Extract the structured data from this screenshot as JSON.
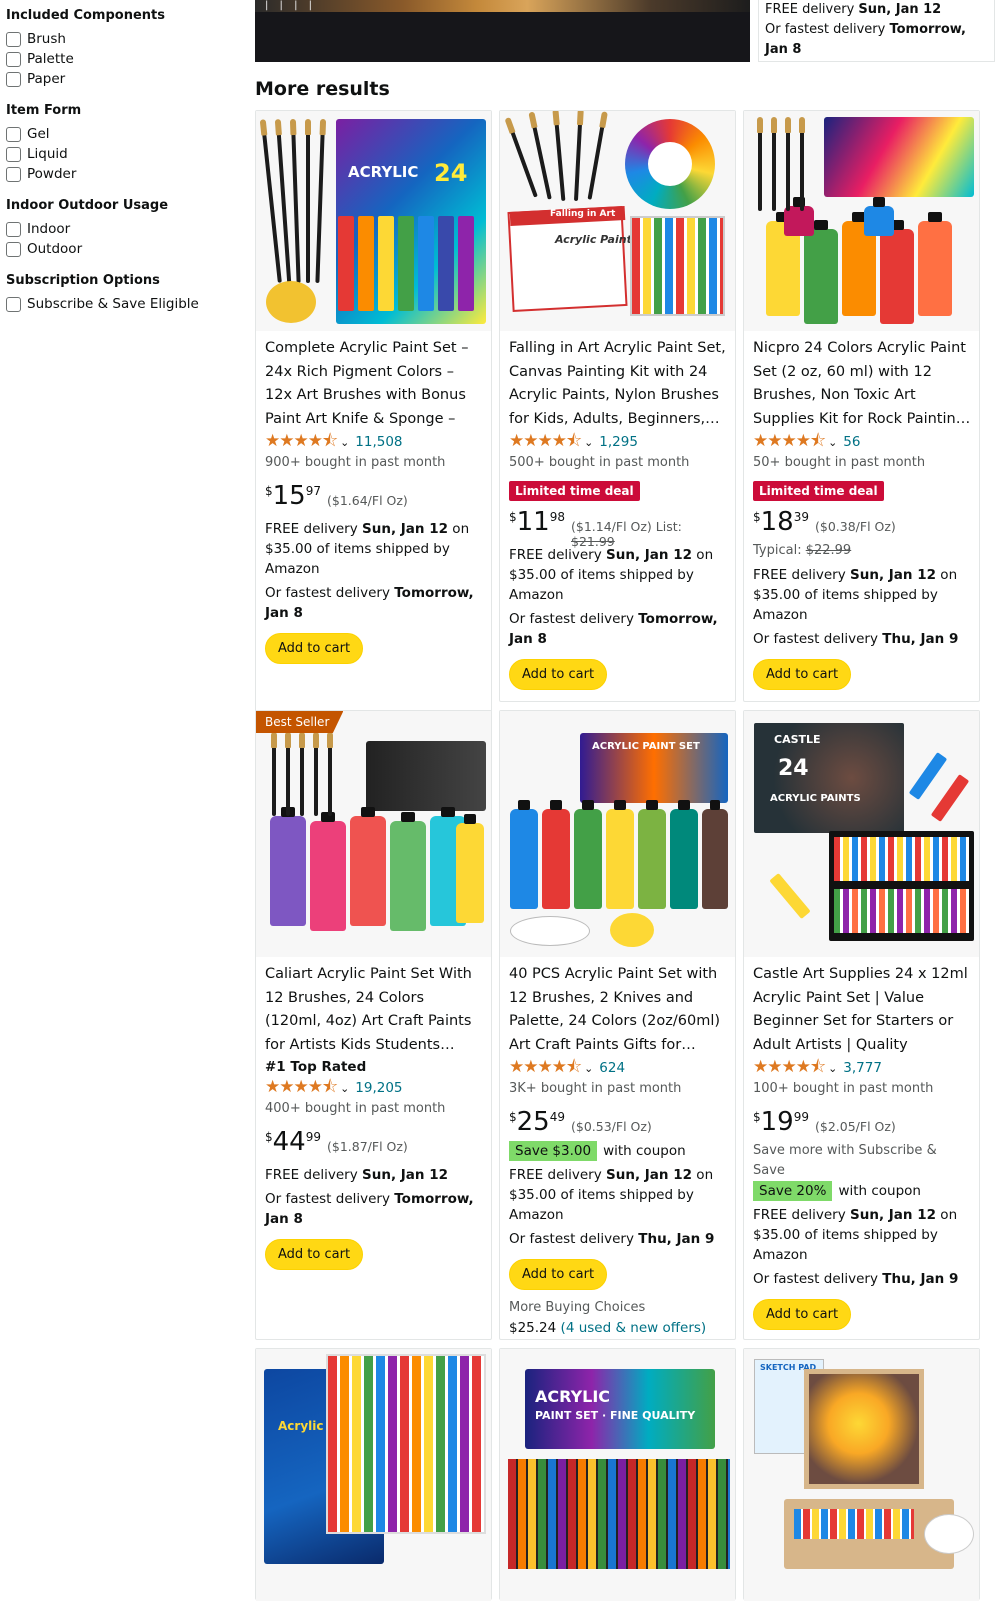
{
  "sidebar": {
    "groups": [
      {
        "heading": "Included Components",
        "options": [
          "Brush",
          "Palette",
          "Paper"
        ]
      },
      {
        "heading": "Item Form",
        "options": [
          "Gel",
          "Liquid",
          "Powder"
        ]
      },
      {
        "heading": "Indoor Outdoor Usage",
        "options": [
          "Indoor",
          "Outdoor"
        ]
      },
      {
        "heading": "Subscription Options",
        "options": [
          "Subscribe & Save Eligible"
        ]
      }
    ]
  },
  "top_strip": {
    "line1_prefix": "FREE delivery ",
    "line1_date": "Sun, Jan 12",
    "line2_prefix": "Or fastest delivery ",
    "line2_date": "Tomorrow, Jan 8"
  },
  "section_heading": "More results",
  "products": [
    {
      "title": "Complete Acrylic Paint Set – 24x Rich Pigment Colors – 12x Art Brushes with Bonus Paint Art Knife & Sponge – for…",
      "rating": "4.5",
      "rating_count": "11,508",
      "bought": "900+ bought in past month",
      "price_whole": "15",
      "price_frac": "97",
      "unit_price": "($1.64/Fl Oz)",
      "delivery_prefix": "FREE delivery ",
      "delivery_date": "Sun, Jan 12",
      "delivery_suffix": " on $35.00 of items shipped by Amazon",
      "fastest_prefix": "Or fastest delivery ",
      "fastest_date": "Tomorrow, Jan 8",
      "button": "Add to cart",
      "image": "acrylic-paint-set-24-tubes-with-brushes"
    },
    {
      "title": "Falling in Art Acrylic Paint Set, Canvas Painting Kit with 24 Acrylic Paints, Nylon Brushes for Kids, Adults, Beginners,…",
      "rating": "4.5",
      "rating_count": "1,295",
      "bought": "500+ bought in past month",
      "badge": "Limited time deal",
      "price_whole": "11",
      "price_frac": "98",
      "unit_price": "($1.14/Fl Oz)",
      "list_label": "List: ",
      "list_price": "$21.99",
      "delivery_prefix": "FREE delivery ",
      "delivery_date": "Sun, Jan 12",
      "delivery_suffix": " on $35.00 of items shipped by Amazon",
      "fastest_prefix": "Or fastest delivery ",
      "fastest_date": "Tomorrow, Jan 8",
      "button": "Add to cart",
      "image": "falling-in-art-paint-kit-with-color-wheel",
      "image_text": [
        "Falling in Art",
        "Acrylic Paint"
      ]
    },
    {
      "title": "Nicpro 24 Colors Acrylic Paint Set (2 oz, 60 ml) with 12 Brushes, Non Toxic Art Supplies Kit for Rock Paintin…",
      "rating": "4.5",
      "rating_count": "56",
      "bought": "50+ bought in past month",
      "badge": "Limited time deal",
      "price_whole": "18",
      "price_frac": "39",
      "unit_price": "($0.38/Fl Oz)",
      "typical_label": "Typical: ",
      "typical_price": "$22.99",
      "delivery_prefix": "FREE delivery ",
      "delivery_date": "Sun, Jan 12",
      "delivery_suffix": " on $35.00 of items shipped by Amazon",
      "fastest_prefix": "Or fastest delivery ",
      "fastest_date": "Thu, Jan 9",
      "button": "Add to cart",
      "image": "nicpro-paint-bottles-with-brushes"
    },
    {
      "best_seller": "Best Seller",
      "title": "Caliart Acrylic Paint Set With 12 Brushes, 24 Colors (120ml, 4oz) Art Craft Paints for Artists Kids Students…",
      "top_rated": "#1 Top Rated",
      "rating": "4.5",
      "rating_count": "19,205",
      "bought": "400+ bought in past month",
      "price_whole": "44",
      "price_frac": "99",
      "unit_price": "($1.87/Fl Oz)",
      "delivery_prefix": "FREE delivery ",
      "delivery_date": "Sun, Jan 12",
      "delivery_suffix": "",
      "fastest_prefix": "Or fastest delivery ",
      "fastest_date": "Tomorrow, Jan 8",
      "button": "Add to cart",
      "image": "caliart-paint-bottles-with-box"
    },
    {
      "title": "40 PCS Acrylic Paint Set with 12 Brushes, 2 Knives and Palette, 24 Colors (2oz/60ml) Art Craft Paints Gifts for…",
      "rating": "4.5",
      "rating_count": "624",
      "bought": "3K+ bought in past month",
      "price_whole": "25",
      "price_frac": "49",
      "unit_price": "($0.53/Fl Oz)",
      "save_badge": "Save $3.00",
      "save_suffix": " with coupon",
      "delivery_prefix": "FREE delivery ",
      "delivery_date": "Sun, Jan 12",
      "delivery_suffix": " on $35.00 of items shipped by Amazon",
      "fastest_prefix": "Or fastest delivery ",
      "fastest_date": "Thu, Jan 9",
      "button": "Add to cart",
      "image": "40-pcs-acrylic-paint-set",
      "more_choices": "More Buying Choices",
      "more_price": "$25.24",
      "more_link": "(4 used & new offers)"
    },
    {
      "title": "Castle Art Supplies 24 x 12ml Acrylic Paint Set | Value Beginner Set for Starters or Adult Artists | Quality Intens…",
      "rating": "4.5",
      "rating_count": "3,777",
      "bought": "100+ bought in past month",
      "price_whole": "19",
      "price_frac": "99",
      "unit_price": "($2.05/Fl Oz)",
      "subscribe_note": "Save more with Subscribe & Save",
      "save_badge": "Save 20%",
      "save_suffix": " with coupon",
      "delivery_prefix": "FREE delivery ",
      "delivery_date": "Sun, Jan 12",
      "delivery_suffix": " on $35.00 of items shipped by Amazon",
      "fastest_prefix": "Or fastest delivery ",
      "fastest_date": "Thu, Jan 9",
      "button": "Add to cart",
      "image": "castle-art-acrylic-paint-tubes"
    }
  ],
  "bottom_images": [
    "artists-acrylic-colour-set",
    "acrylic-paint-set-fine-quality",
    "sketch-pad-easel-paint-set"
  ]
}
